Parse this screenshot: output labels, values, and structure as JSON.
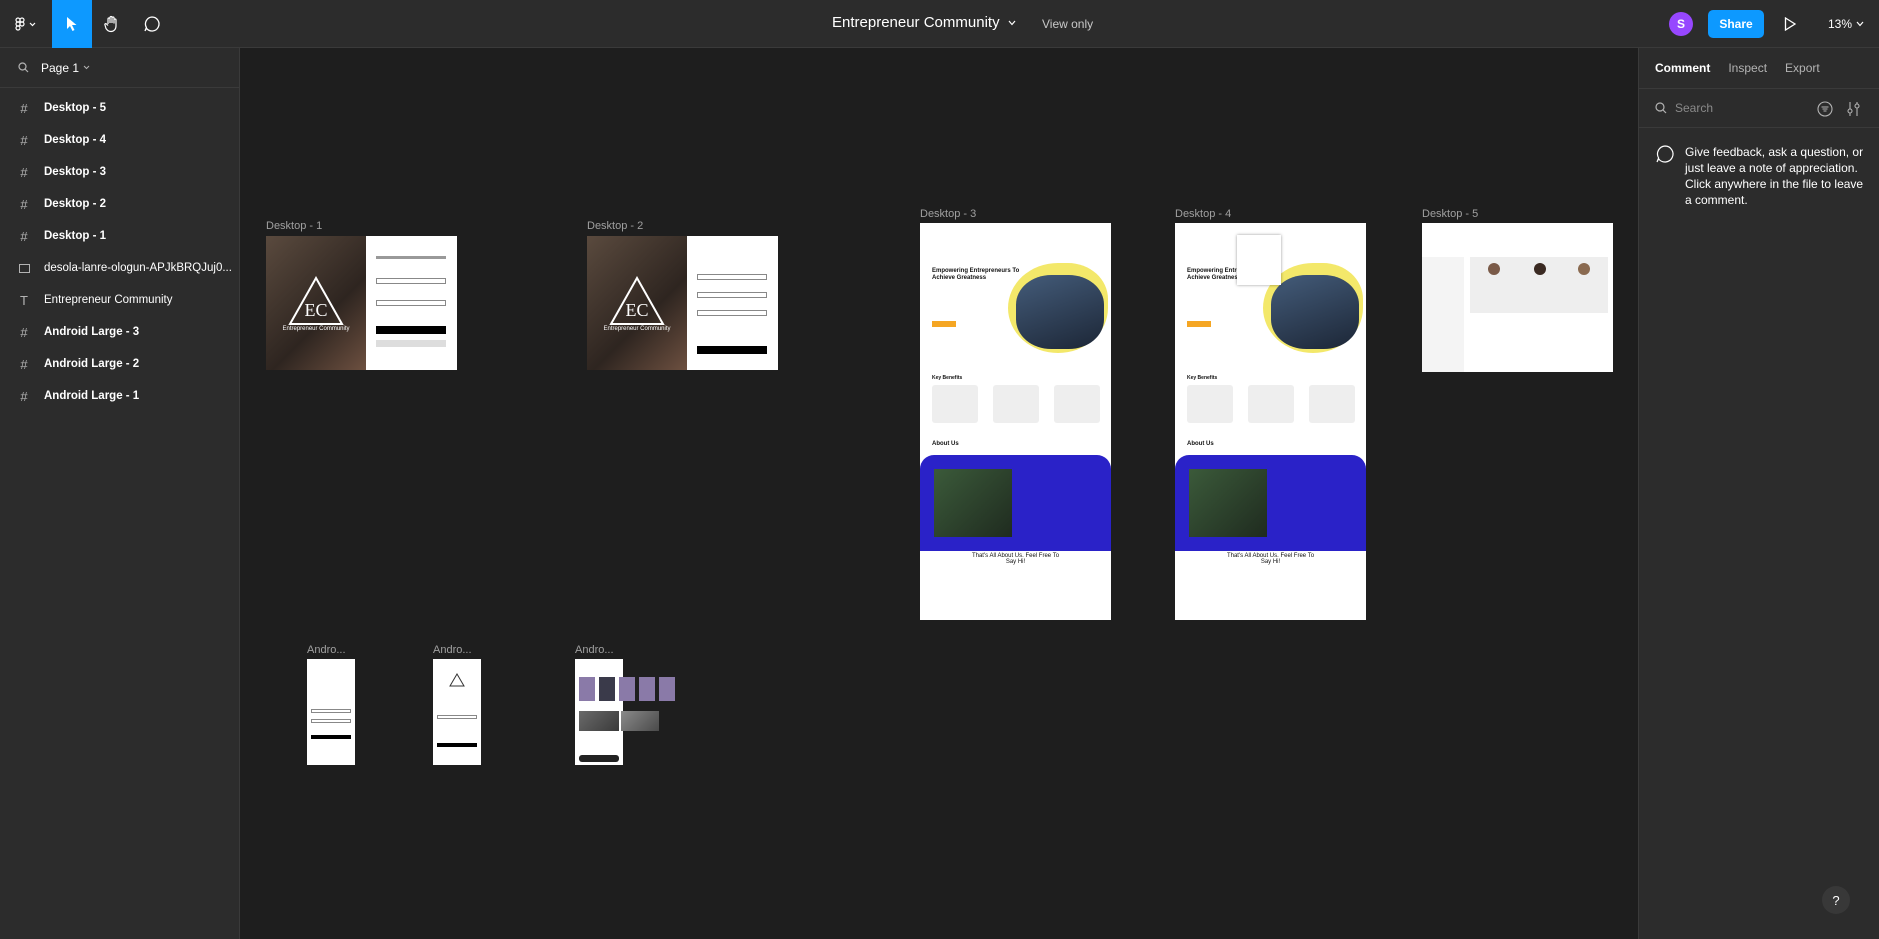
{
  "toolbar": {
    "title": "Entrepreneur Community",
    "view_only": "View only",
    "avatar_initial": "S",
    "share_label": "Share",
    "zoom": "13%"
  },
  "left_panel": {
    "page_label": "Page 1",
    "layers": [
      {
        "label": "Desktop - 5",
        "icon": "frame-icon",
        "bold": true
      },
      {
        "label": "Desktop - 4",
        "icon": "frame-icon",
        "bold": true
      },
      {
        "label": "Desktop - 3",
        "icon": "frame-icon",
        "bold": true
      },
      {
        "label": "Desktop - 2",
        "icon": "frame-icon",
        "bold": true
      },
      {
        "label": "Desktop - 1",
        "icon": "frame-icon",
        "bold": true
      },
      {
        "label": "desola-lanre-ologun-APJkBRQJuj0...",
        "icon": "rectangle-icon",
        "bold": false
      },
      {
        "label": "Entrepreneur Community",
        "icon": "text-icon",
        "bold": false
      },
      {
        "label": "Android Large - 3",
        "icon": "frame-icon",
        "bold": true
      },
      {
        "label": "Android Large - 2",
        "icon": "frame-icon",
        "bold": true
      },
      {
        "label": "Android Large - 1",
        "icon": "frame-icon",
        "bold": true
      }
    ]
  },
  "canvas": {
    "frames": {
      "desktop1": "Desktop - 1",
      "desktop2": "Desktop - 2",
      "desktop3": "Desktop - 3",
      "desktop4": "Desktop - 4",
      "desktop5": "Desktop - 5",
      "android1": "Andro...",
      "android2": "Andro...",
      "android3": "Andro..."
    },
    "brand_caption": "Entrepreneur Community",
    "hero_heading": "Empowering Entrepreneurs To Achieve Greatness",
    "key_benefits": "Key Benefits",
    "about_us": "About Us",
    "cta_text": "That's All About Us. Feel Free To Say Hi!"
  },
  "right_panel": {
    "tabs": [
      "Comment",
      "Inspect",
      "Export"
    ],
    "search_placeholder": "Search",
    "note": "Give feedback, ask a question, or just leave a note of appreciation. Click anywhere in the file to leave a comment."
  },
  "colors": {
    "accent": "#0d99ff",
    "avatar": "#9747ff",
    "about_blue": "#2a22c8"
  }
}
